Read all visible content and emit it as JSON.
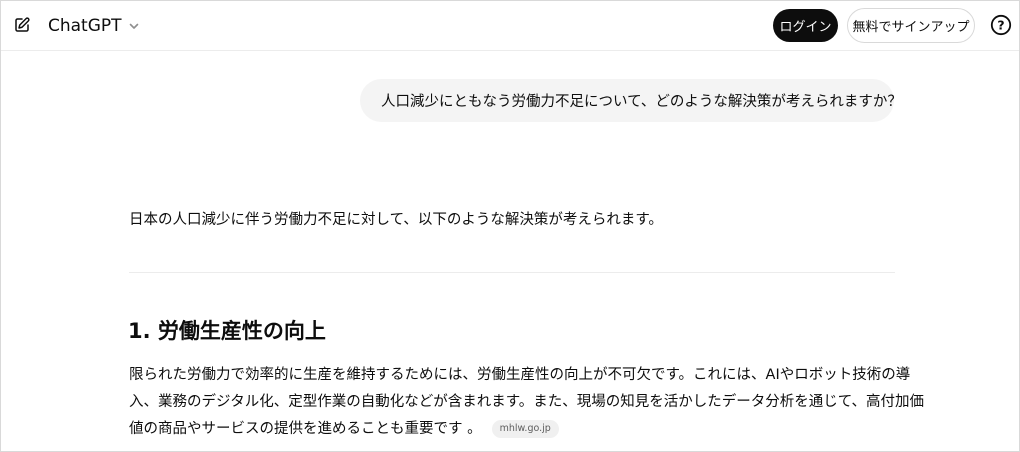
{
  "header": {
    "model_name": "ChatGPT",
    "login_label": "ログイン",
    "signup_label": "無料でサインアップ",
    "help_label": "?"
  },
  "conversation": {
    "user_message": "人口減少にともなう労働力不足について、どのような解決策が考えられますか？",
    "assistant": {
      "intro": "日本の人口減少に伴う労働力不足に対して、以下のような解決策が考えられます。",
      "sections": [
        {
          "heading": "1. 労働生産性の向上",
          "lines": [
            "限られた労働力で効率的に生産を維持するためには、労働生産性の向上が不可欠です。これには、AIやロボット技術の導",
            "入、業務のデジタル化、定型作業の自動化などが含まれます。また、現場の知見を活かしたデータ分析を通じて、高付加価",
            "値の商品やサービスの提供を進めることも重要です 。"
          ],
          "source": "mhlw.go.jp"
        }
      ]
    }
  },
  "colors": {
    "primary_button": "#0d0d0d",
    "bubble_bg": "#f4f4f4",
    "border": "#d9d9d9"
  },
  "icons": {
    "new_chat": "edit-pencil-icon",
    "model_dropdown": "chevron-down-icon",
    "help": "question-circle-icon"
  }
}
